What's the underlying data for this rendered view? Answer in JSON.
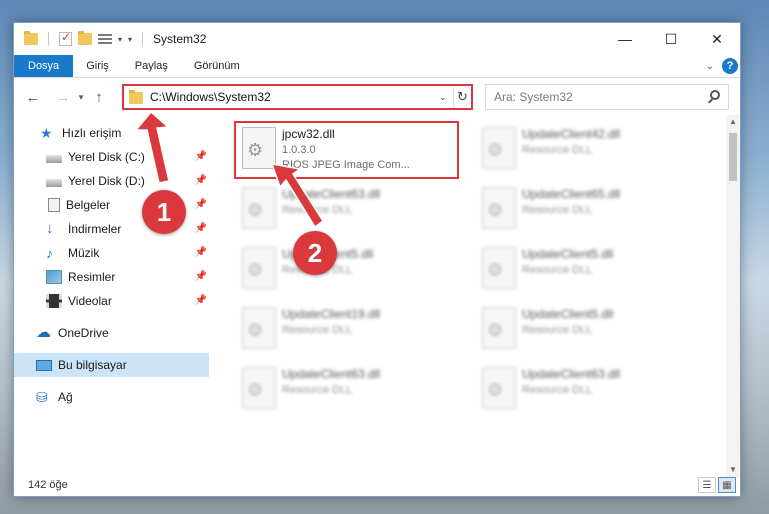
{
  "window": {
    "title": "System32",
    "controls": {
      "minimize": "—",
      "maximize": "☐",
      "close": "✕"
    }
  },
  "ribbon": {
    "tabs": [
      "Dosya",
      "Giriş",
      "Paylaş",
      "Görünüm"
    ],
    "help": "?"
  },
  "address": {
    "path": "C:\\Windows\\System32",
    "search_placeholder": "Ara: System32"
  },
  "sidebar": {
    "items": [
      {
        "label": "Hızlı erişim",
        "icon": "star-icon",
        "pinned": false
      },
      {
        "label": "Yerel Disk (C:)",
        "icon": "disk-icon",
        "pinned": true
      },
      {
        "label": "Yerel Disk (D:)",
        "icon": "disk-icon",
        "pinned": true
      },
      {
        "label": "Belgeler",
        "icon": "document-icon",
        "pinned": true
      },
      {
        "label": "İndirmeler",
        "icon": "download-icon",
        "pinned": true
      },
      {
        "label": "Müzik",
        "icon": "music-icon",
        "pinned": true
      },
      {
        "label": "Resimler",
        "icon": "pictures-icon",
        "pinned": true
      },
      {
        "label": "Videolar",
        "icon": "video-icon",
        "pinned": true
      },
      {
        "label": "OneDrive",
        "icon": "onedrive-icon",
        "pinned": false
      },
      {
        "label": "Bu bilgisayar",
        "icon": "computer-icon",
        "pinned": false,
        "selected": true
      },
      {
        "label": "Ağ",
        "icon": "network-icon",
        "pinned": false
      }
    ]
  },
  "files": [
    {
      "name": "jpcw32.dll",
      "line2": "1.0.3.0",
      "line3": "RIOS JPEG Image Com...",
      "highlight": true
    },
    {
      "name": "UpdateClient42.dll",
      "line2": "Resource DLL"
    },
    {
      "name": "UpdateClient63.dll",
      "line2": "Resource DLL"
    },
    {
      "name": "UpdateClient65.dll",
      "line2": "Resource DLL"
    },
    {
      "name": "UpdateClient5.dll",
      "line2": "Resource DLL"
    },
    {
      "name": "UpdateClient5.dll",
      "line2": "Resource DLL"
    },
    {
      "name": "UpdateClient19.dll",
      "line2": "Resource DLL"
    },
    {
      "name": "UpdateClient5.dll",
      "line2": "Resource DLL"
    },
    {
      "name": "UpdateClient63.dll",
      "line2": "Resource DLL"
    },
    {
      "name": "UpdateClient63.dll",
      "line2": "Resource DLL"
    }
  ],
  "status": {
    "count": "142 öğe"
  },
  "annotations": {
    "step1": "1",
    "step2": "2"
  },
  "colors": {
    "accent": "#1979ca",
    "highlight": "#d9393d",
    "selected": "#cce4f7"
  }
}
